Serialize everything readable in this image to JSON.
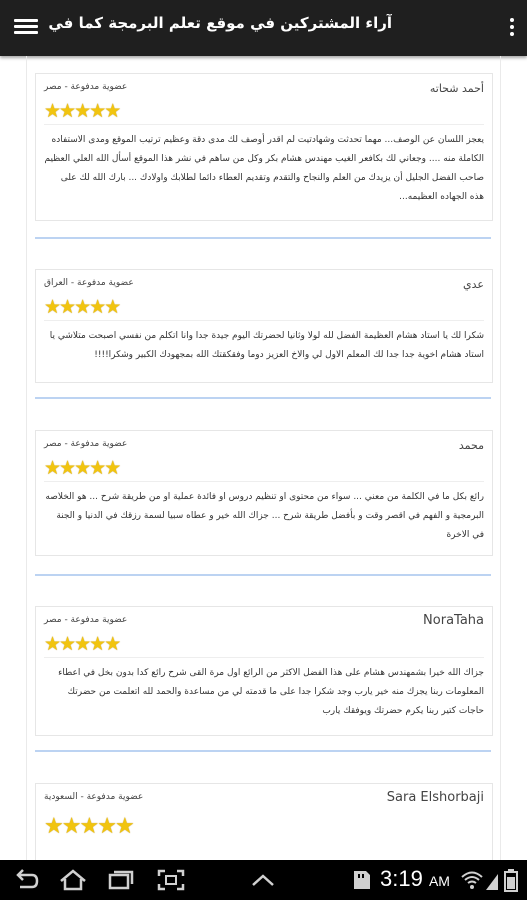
{
  "appbar": {
    "title": "آراء المشتركين في موقع تعلم البرمجة كما في شركات البرمجة"
  },
  "reviews": [
    {
      "name": "أحمد شحاته",
      "membership": "عضوية مدفوعة - مصر",
      "rating": 5,
      "comment": "يعجز اللسان عن الوصف... مهما تحدثت وشهادتيت لم اقدر أوصف لك مدى دقة وعظيم ترتيب الموقع ومدى الاستفاده الكاملة منه .... وجعاني لك بكافعر الغيب مهندس هشام بكر وكل من ساهم في نشر هذا الموقع أسأل الله العلي العظيم صاحب الفضل الجليل أن يزيدك من العلم والنجاح والتقدم وتقديم العطاء دائما لطلابك واولادك ... بارك الله لك على هذه الجهاده العظيمه..."
    },
    {
      "name": "عدي",
      "membership": "عضوية مدفوعة - العراق",
      "rating": 5,
      "comment": "شكرا لك يا استاد هشام العظيمة الفضل لله لولا وثانيا لحضرتك اليوم جيدة جدا وانا اتكلم من نفسي اصبحت متلاشي يا استاد هشام اخوية جدا جدا لك المعلم الاول لي والاخ العزيز دوما وفقكقتك الله بمجهودك الكبير وشكرا!!!!"
    },
    {
      "name": "محمد",
      "membership": "عضوية مدفوعة - مصر",
      "rating": 5,
      "comment": "رائع بكل ما في الكلمة من معني ... سواء من محتوى او تنظيم دروس او فائدة عملية او من طريقة شرح ... هو الخلاصه البرمجية و الفهم في اقصر وقت و بأفضل طريقة شرح ... جزاك الله خير و عطاه سبيا لسمة رزقك في الدنيا و الجنة في الاخرة"
    },
    {
      "name": "NoraTaha",
      "membership": "عضوية مدفوعة - مصر",
      "rating": 5,
      "comment": "جزاك الله خيرا بشمهندس هشام على هذا الفضل الاكثر من الرائع اول مرة القى شرح رائع كدا بدون بخل في اعطاء المعلومات ربنا يجزك منه خير يارب وجد شكرا جدا على ما قدمته لي من مساعدة والحمد لله اتعلمت من حضرتك حاجات كتير ربنا يكرم حضرتك ويوفقك يارب"
    },
    {
      "name": "Sara Elshorbaji",
      "membership": "عضوية مدفوعة - السعودية",
      "rating": 5,
      "comment": ""
    }
  ],
  "status": {
    "time": "3:19",
    "ampm": "AM"
  }
}
